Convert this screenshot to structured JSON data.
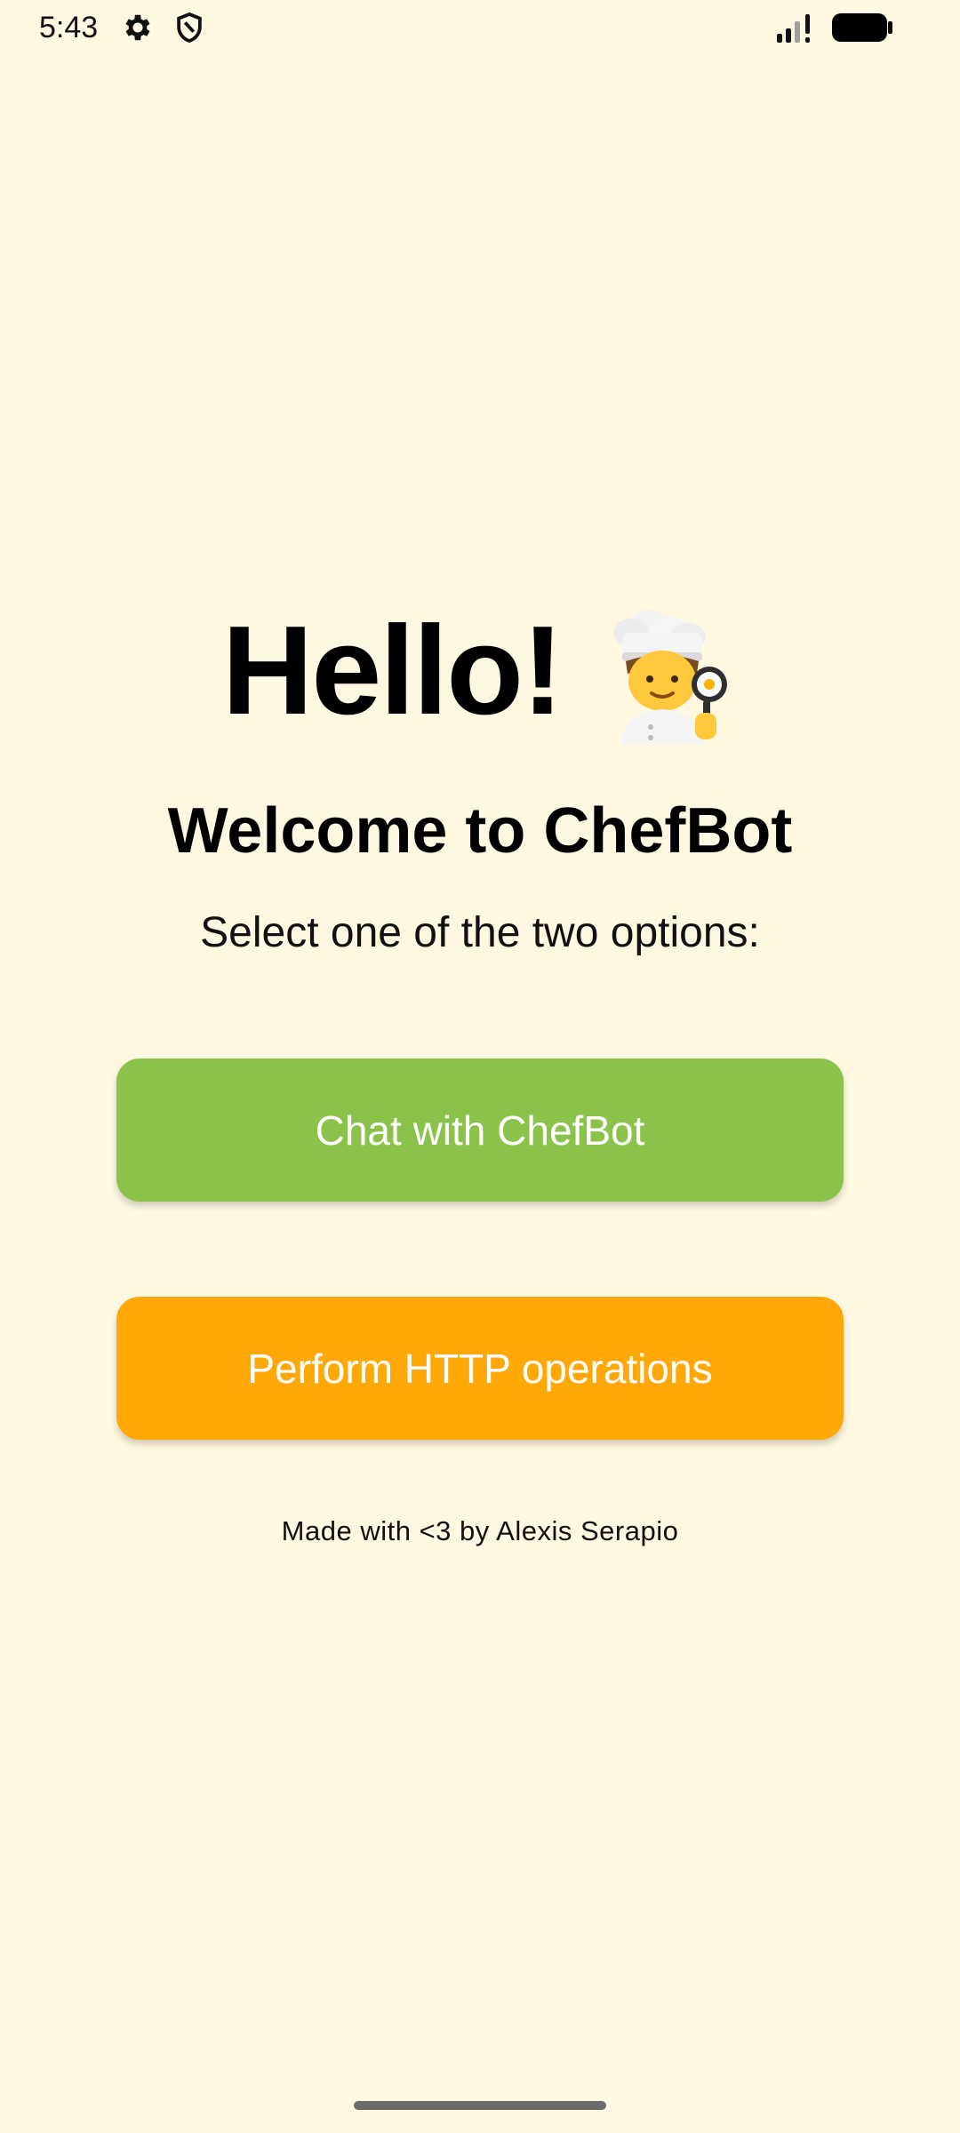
{
  "status_bar": {
    "time": "5:43",
    "icons": [
      "gear-icon",
      "shield-icon",
      "signal-icon",
      "battery-icon"
    ]
  },
  "main": {
    "hello": "Hello!",
    "hello_icon": "chef-emoji-icon",
    "title": "Welcome to ChefBot",
    "subtitle": "Select one of the two options:"
  },
  "buttons": {
    "chat_label": "Chat with ChefBot",
    "http_label": "Perform HTTP operations"
  },
  "footer": {
    "text": "Made with <3 by Alexis Serapio"
  },
  "colors": {
    "background": "#FFF8E1",
    "chat_button": "#8BC34A",
    "http_button": "#FFA808",
    "text": "#000000"
  }
}
